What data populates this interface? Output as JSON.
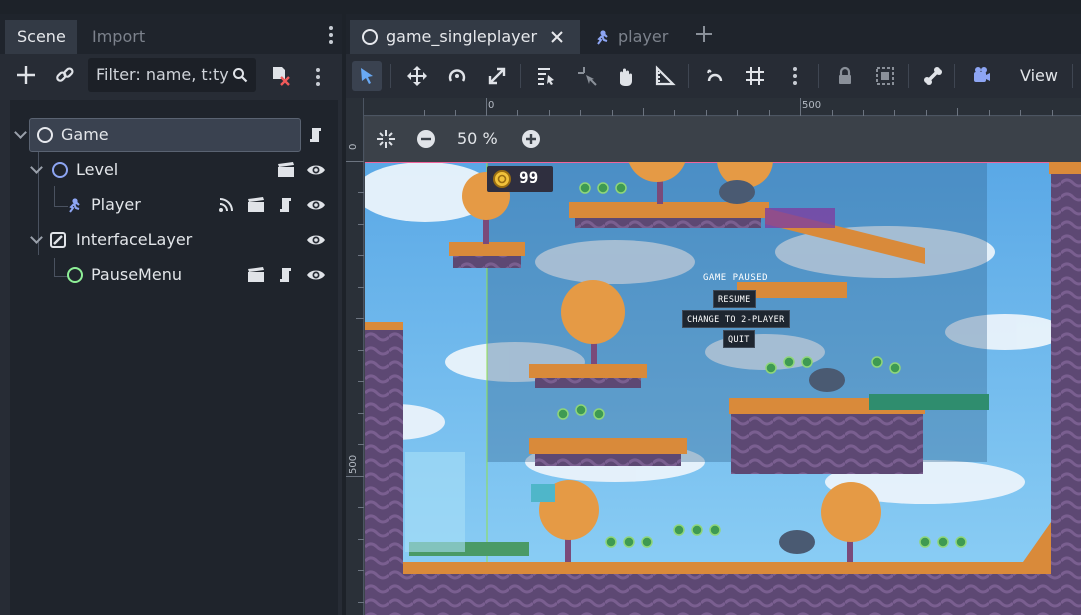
{
  "scene_dock": {
    "tabs": [
      {
        "label": "Scene"
      },
      {
        "label": "Import"
      }
    ],
    "filter_placeholder": "Filter: name, t:ty",
    "tree": [
      {
        "label": "Game",
        "icon": "node-circle-icon"
      },
      {
        "label": "Level",
        "icon": "node-circle-icon"
      },
      {
        "label": "Player",
        "icon": "character-icon"
      },
      {
        "label": "InterfaceLayer",
        "icon": "canvas-layer-icon"
      },
      {
        "label": "PauseMenu",
        "icon": "control-circle-icon"
      }
    ]
  },
  "editor": {
    "tabs": [
      {
        "label": "game_singleplayer"
      },
      {
        "label": "player"
      }
    ],
    "view_menu": "View",
    "zoom": "50 %",
    "ruler": {
      "x": [
        "0",
        "500"
      ],
      "y": [
        "0",
        "500"
      ]
    }
  },
  "game": {
    "coin_count": "99",
    "pause_title": "GAME PAUSED",
    "resume": "RESUME",
    "change": "CHANGE TO 2-PLAYER",
    "quit": "QUIT"
  },
  "colors": {
    "accent": "#4d8fd6",
    "node_icon": "#8da5f3",
    "control_icon": "#8eef97",
    "sky": "#6cb8ec",
    "ground_orange": "#d9893a",
    "rock_purple": "#5a4a6e"
  }
}
